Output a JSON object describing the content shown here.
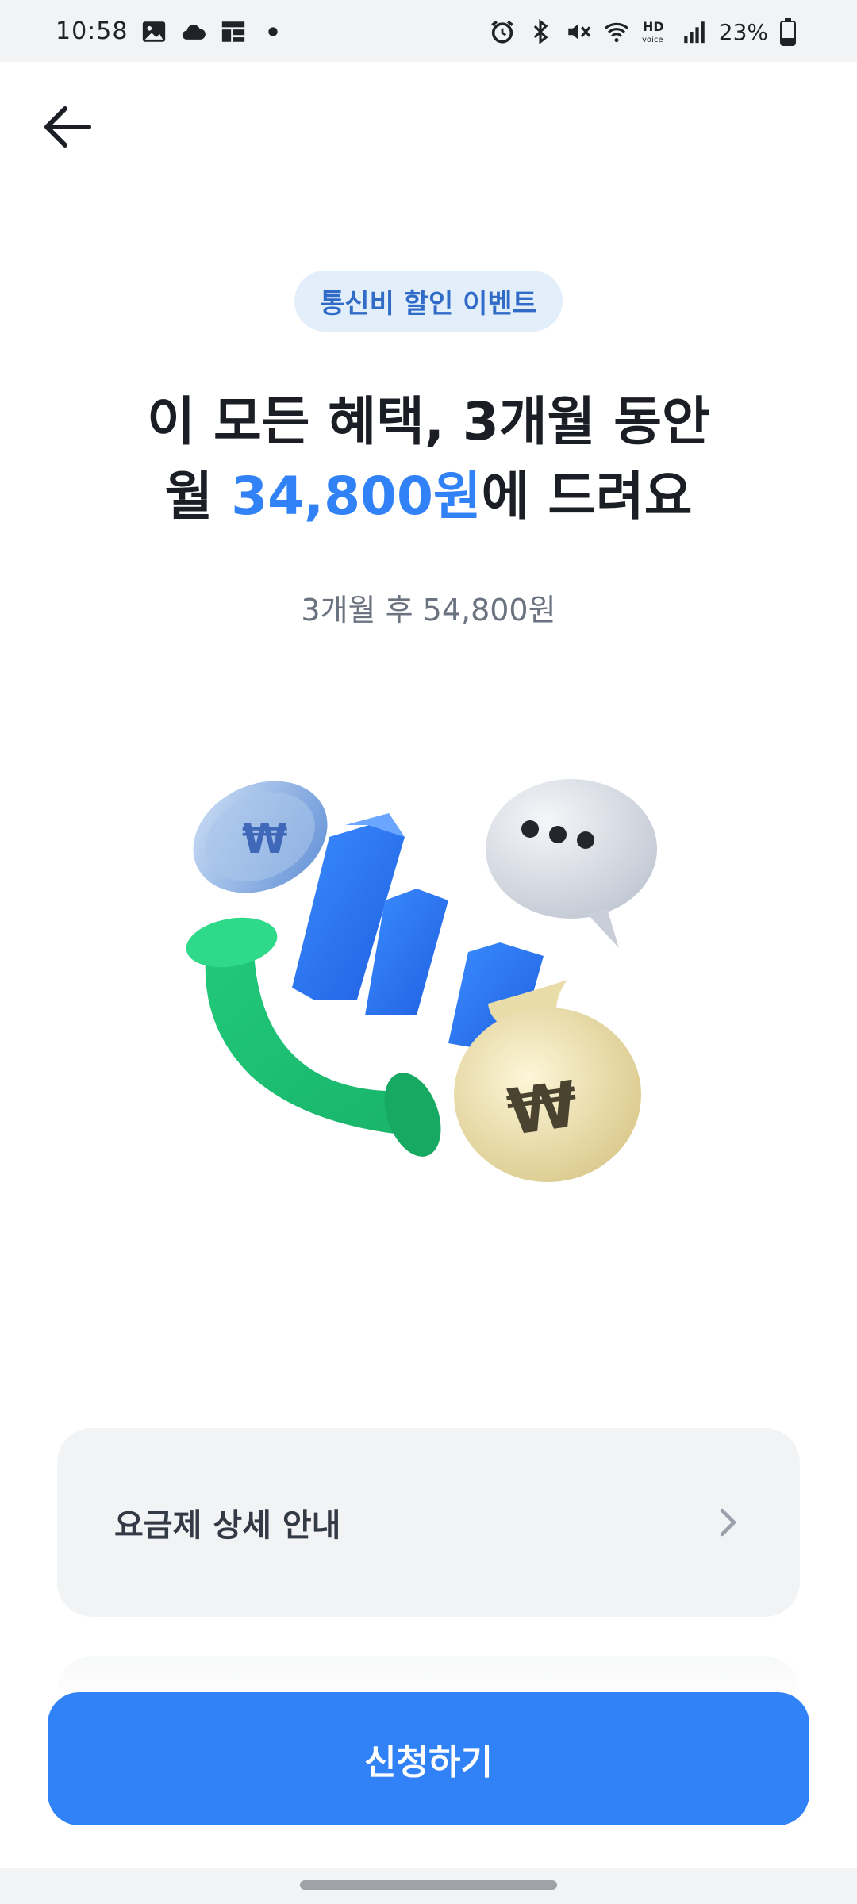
{
  "status_bar": {
    "time": "10:58",
    "battery": "23%",
    "hd_label": "HD",
    "voice_label": "voice",
    "left_icons": [
      "image-icon",
      "cloud-icon",
      "grid-app-icon",
      "dot-icon"
    ],
    "right_icons": [
      "alarm-icon",
      "bluetooth-icon",
      "mute-icon",
      "wifi-icon",
      "hd-voice-icon",
      "signal-icon",
      "battery-icon"
    ]
  },
  "header": {
    "back_icon": "arrow-left-icon"
  },
  "promo": {
    "badge": "통신비 할인 이벤트",
    "headline_line1": "이 모든 혜택, 3개월 동안",
    "headline_prefix": "월 ",
    "headline_price": "34,800원",
    "headline_suffix": "에 드려요",
    "subtext": "3개월 후 54,800원",
    "accent_color": "#3182f6"
  },
  "detail": {
    "label": "요금제 상세 안내",
    "chevron_icon": "chevron-right-icon"
  },
  "cta": {
    "label": "신청하기",
    "color": "#3182f6"
  }
}
